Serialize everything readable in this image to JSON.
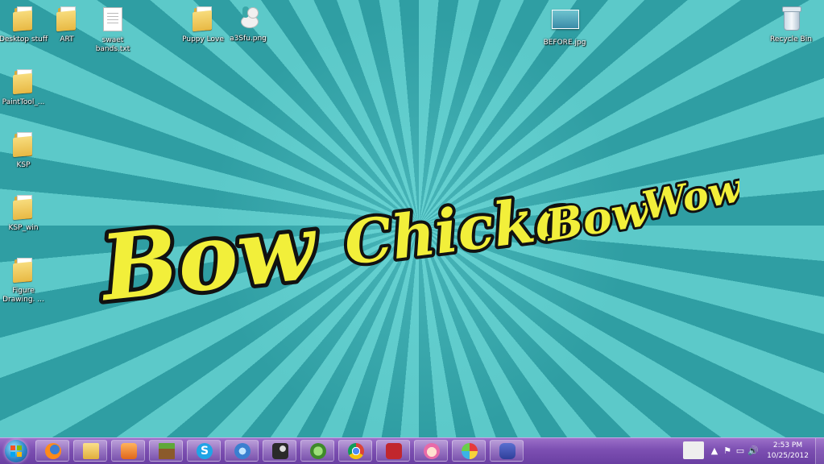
{
  "desktop": {
    "icons": [
      {
        "id": "desktop-stuff",
        "label": "Desktop stuff",
        "type": "folder"
      },
      {
        "id": "art",
        "label": "ART",
        "type": "folder"
      },
      {
        "id": "swaet-bands",
        "label": "swaet bands.txt",
        "type": "text-file"
      },
      {
        "id": "puppy-love",
        "label": "Puppy Love",
        "type": "folder"
      },
      {
        "id": "a3sfu",
        "label": "a3Sfu.png",
        "type": "image-file"
      },
      {
        "id": "before-jpg",
        "label": "BEFORE.jpg",
        "type": "image-file"
      },
      {
        "id": "recycle-bin",
        "label": "Recycle Bin",
        "type": "recycle-bin"
      },
      {
        "id": "painttool",
        "label": "PaintTool_...",
        "type": "folder"
      },
      {
        "id": "ksp",
        "label": "KSP",
        "type": "folder"
      },
      {
        "id": "ksp-win",
        "label": "KSP_win",
        "type": "folder"
      },
      {
        "id": "figure-drawing",
        "label": "Figure Drawing. ...",
        "type": "pdf-folder"
      }
    ],
    "wallpaper": {
      "headline_words": [
        "Bow",
        "Chicka",
        "Bow",
        "Wow"
      ],
      "text_color": "#f2ef3a",
      "outline_color": "#111111",
      "ray_colors": [
        "#5cc9c9",
        "#2f9ea3"
      ]
    }
  },
  "taskbar": {
    "start_label": "Start",
    "pinned": [
      {
        "id": "firefox",
        "icon": "firefox-icon",
        "active": true
      },
      {
        "id": "explorer",
        "icon": "folder-icon",
        "active": false
      },
      {
        "id": "media-player",
        "icon": "media-player-icon",
        "active": false
      },
      {
        "id": "minecraft",
        "icon": "minecraft-icon",
        "active": false
      },
      {
        "id": "skype",
        "icon": "skype-icon",
        "active": false
      },
      {
        "id": "itunes",
        "icon": "itunes-icon",
        "active": false
      },
      {
        "id": "steam",
        "icon": "steam-icon",
        "active": false
      },
      {
        "id": "game",
        "icon": "game-icon",
        "active": false
      },
      {
        "id": "chrome",
        "icon": "chrome-icon",
        "active": false
      },
      {
        "id": "acrobat",
        "icon": "acrobat-icon",
        "active": false
      },
      {
        "id": "anime-app",
        "icon": "character-icon",
        "active": false
      },
      {
        "id": "paint",
        "icon": "paint-icon",
        "active": false
      },
      {
        "id": "gameboy",
        "icon": "gameboy-icon",
        "active": false
      }
    ],
    "clock": {
      "time": "2:53 PM",
      "date": "10/25/2012"
    },
    "colors": {
      "bar_top": "#9b6fc9",
      "bar_bottom": "#6a3fa2"
    }
  }
}
